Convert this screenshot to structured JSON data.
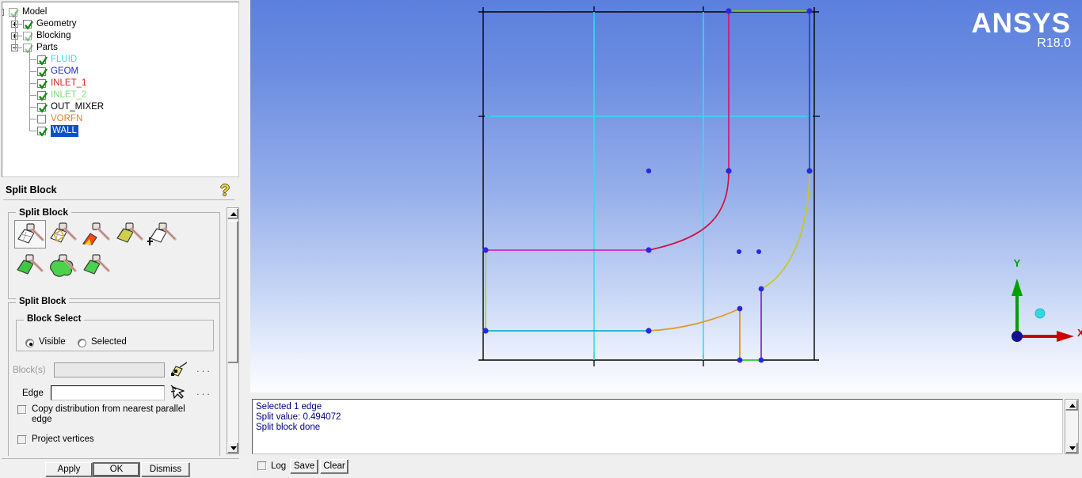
{
  "tree": {
    "nodes": [
      {
        "label": "Model",
        "indent": 0,
        "expander": "minus",
        "checkbox": "greyed-check",
        "color": "#000000"
      },
      {
        "label": "Geometry",
        "indent": 1,
        "expander": "plus",
        "checkbox": "check",
        "color": "#000000"
      },
      {
        "label": "Blocking",
        "indent": 1,
        "expander": "plus",
        "checkbox": "greyed-check",
        "color": "#000000"
      },
      {
        "label": "Parts",
        "indent": 1,
        "expander": "minus",
        "checkbox": "greyed-check",
        "color": "#000000"
      },
      {
        "label": "FLUID",
        "indent": 2,
        "expander": "none",
        "checkbox": "check",
        "color": "#44d5e0"
      },
      {
        "label": "GEOM",
        "indent": 2,
        "expander": "none",
        "checkbox": "check",
        "color": "#2424b4"
      },
      {
        "label": "INLET_1",
        "indent": 2,
        "expander": "none",
        "checkbox": "check",
        "color": "#d92020"
      },
      {
        "label": "INLET_2",
        "indent": 2,
        "expander": "none",
        "checkbox": "check",
        "color": "#79df79"
      },
      {
        "label": "OUT_MIXER",
        "indent": 2,
        "expander": "none",
        "checkbox": "check",
        "color": "#000000"
      },
      {
        "label": "VORFN",
        "indent": 2,
        "expander": "none",
        "checkbox": "empty",
        "color": "#e08020"
      },
      {
        "label": "WALL",
        "indent": 2,
        "expander": "none",
        "checkbox": "check",
        "color": "#ffffff",
        "selected": true
      }
    ]
  },
  "panel": {
    "title": "Split Block",
    "help_icon": "question-mark-help-icon",
    "toolbox_group": "Split Block",
    "settings_group": "Split Block",
    "icons": [
      {
        "name": "split-block-icon",
        "selected": true
      },
      {
        "name": "split-block-ogrid-icon",
        "selected": false
      },
      {
        "name": "split-block-2d-icon",
        "selected": false
      },
      {
        "name": "split-block-face-icon",
        "selected": false
      },
      {
        "name": "split-block-extend-icon",
        "selected": false
      },
      {
        "name": "split-block-green-icon",
        "selected": false
      },
      {
        "name": "split-block-unstruct-icon",
        "selected": false
      },
      {
        "name": "split-block-merge-icon",
        "selected": false
      }
    ],
    "block_select": {
      "group": "Block Select",
      "options": [
        "Visible",
        "Selected"
      ],
      "selected": "Visible"
    },
    "blocks_field": {
      "label": "Block(s)",
      "value": "",
      "placeholder": "",
      "disabled": true,
      "picker": "select-blocks-icon",
      "dots": "..."
    },
    "edge_field": {
      "label": "Edge",
      "value": "",
      "placeholder": "",
      "disabled": false,
      "picker": "select-edge-cursor-icon",
      "dots": "..."
    },
    "checkboxes": [
      {
        "label": "Copy distribution from nearest parallel edge",
        "checked": false
      },
      {
        "label": "Project vertices",
        "checked": false
      }
    ],
    "buttons": [
      {
        "label": "Apply",
        "default": false
      },
      {
        "label": "OK",
        "default": true
      },
      {
        "label": "Dismiss",
        "default": false
      }
    ]
  },
  "viewport": {
    "logo": {
      "brand": "ANSYS",
      "release": "R18.0"
    },
    "triad": {
      "x_label": "X",
      "y_label": "Y",
      "x_color": "#cc0000",
      "y_color": "#00a000",
      "origin_color": "#101090",
      "z_ball_color": "#30d8e0"
    },
    "colors": {
      "background_top": "#5b80dd",
      "background_bottom": "#fdfdff",
      "geometry_black": "#000000",
      "edge_cyan": "#2ce0f0",
      "edge_magenta": "#e020d0",
      "edge_red": "#d01050",
      "edge_teal": "#16b0c8",
      "edge_olive": "#c8c820",
      "edge_orange": "#e08a20",
      "edge_purple": "#8020c0",
      "edge_blue": "#2040e0",
      "edge_green": "#70d020",
      "vertex_blue": "#2828e0"
    }
  },
  "messages": {
    "lines": [
      {
        "text": "Selected 1 edge",
        "color": "#000080"
      },
      {
        "text": "Split value: 0.494072",
        "color": "#000080"
      },
      {
        "text": "Split block done",
        "color": "#000080"
      }
    ],
    "log_checkbox": {
      "label": "Log",
      "checked": false
    },
    "save_button": "Save",
    "clear_button": "Clear"
  }
}
